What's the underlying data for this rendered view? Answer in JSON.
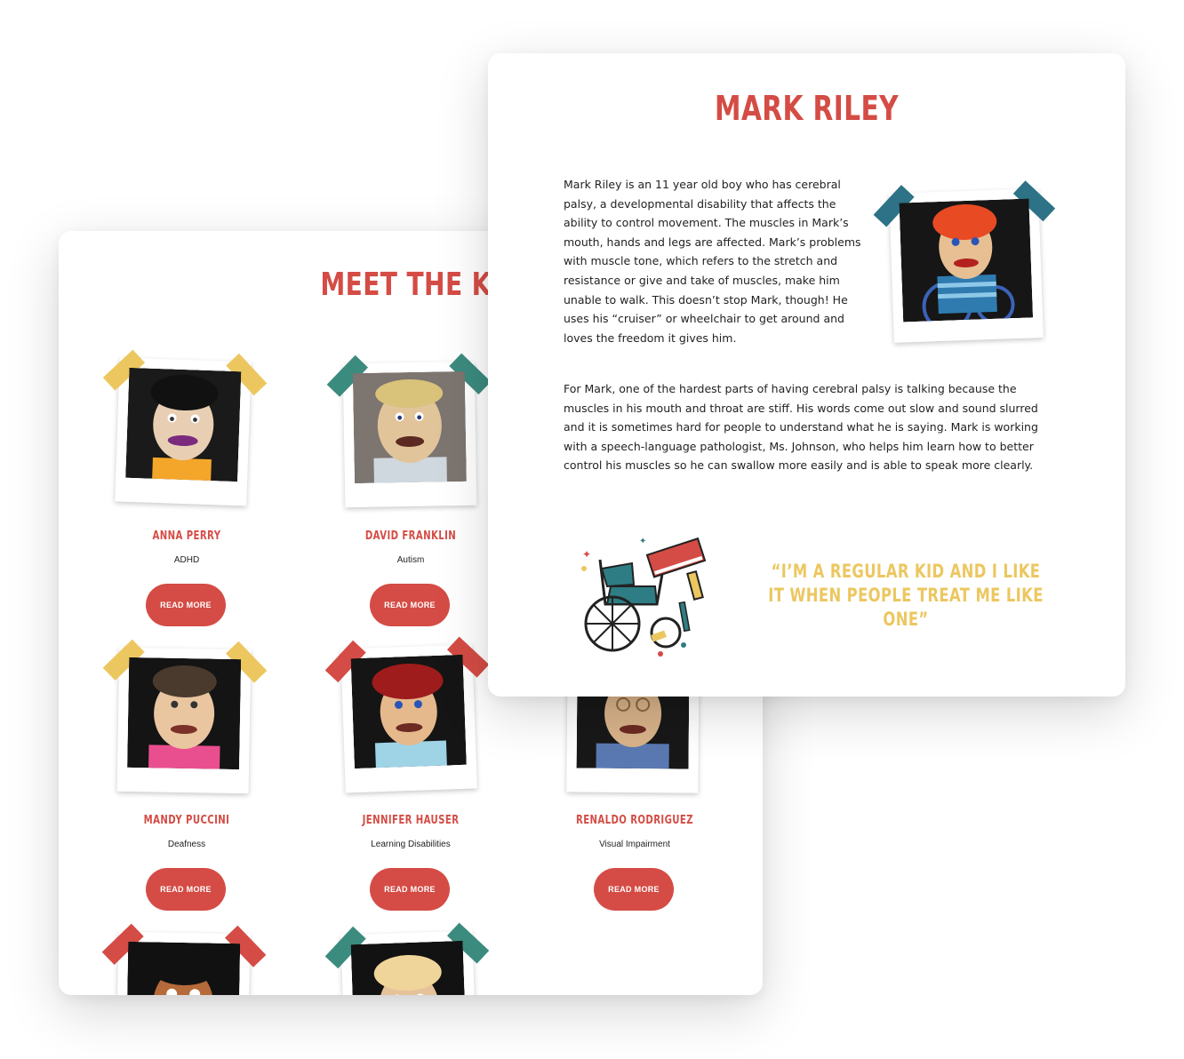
{
  "kids_page": {
    "title": "MEET THE KI",
    "read_more_label": "READ MORE",
    "kids": [
      {
        "name": "ANNA PERRY",
        "condition": "ADHD",
        "tape": "#ecc760"
      },
      {
        "name": "DAVID FRANKLIN",
        "condition": "Autism",
        "tape": "#3c8b7f"
      },
      {
        "name": "MANDY PUCCINI",
        "condition": "Deafness",
        "tape": "#ecc760"
      },
      {
        "name": "JENNIFER HAUSER",
        "condition": "Learning Disabilities",
        "tape": "#d44c45"
      },
      {
        "name": "RENALDO RODRIGUEZ",
        "condition": "Visual Impairment",
        "tape": "#d44c45"
      }
    ]
  },
  "profile": {
    "name": "MARK RILEY",
    "paragraph_1": "Mark Riley is an 11 year old boy who has cerebral palsy, a developmental disability that affects the ability to control movement. The muscles in Mark’s mouth, hands and legs are affected. Mark’s problems with muscle tone, which refers to the stretch and resistance or give and take of muscles, make him unable to walk. This doesn’t stop Mark, though! He uses his “cruiser” or wheelchair to get around and loves the freedom it gives him.",
    "paragraph_2": "For Mark, one of the hardest parts of having cerebral palsy is talking because the muscles in his mouth and throat are stiff. His words come out slow and sound slurred and it is sometimes hard for people to understand what he is saying. Mark is working with a speech-language pathologist, Ms. Johnson, who helps him learn how to better control his muscles so he can swallow more easily and is able to speak more clearly.",
    "quote": "“I’M A REGULAR KID AND I LIKE IT WHEN PEOPLE TREAT ME LIKE ONE”"
  },
  "colors": {
    "accent_red": "#d44c45",
    "quote_yellow": "#ecc760",
    "tape_teal": "#3c8b7f",
    "tape_blue": "#2d7286"
  }
}
